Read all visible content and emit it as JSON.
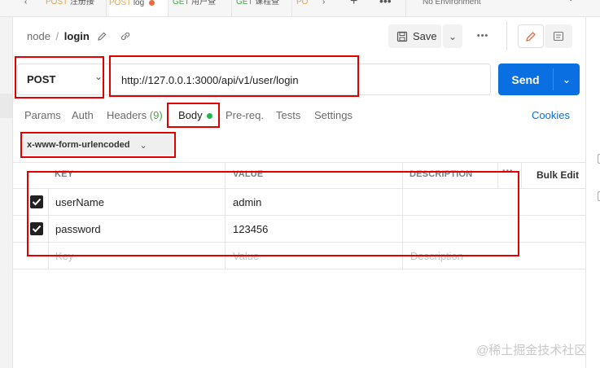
{
  "tabs": [
    {
      "method": "POST",
      "label": "注册接"
    },
    {
      "method": "POST",
      "label": "log",
      "unsaved": true
    },
    {
      "method": "GET",
      "label": "用户查"
    },
    {
      "method": "GET",
      "label": "课程查"
    },
    {
      "method": "PO",
      "label": ""
    }
  ],
  "environment": {
    "label": "No Environment"
  },
  "breadcrumb": {
    "parent": "node",
    "separator": "/",
    "current": "login"
  },
  "toolbar": {
    "save_label": "Save"
  },
  "request": {
    "method": "POST",
    "url": "http://127.0.0.1:3000/api/v1/user/login",
    "send_label": "Send"
  },
  "request_tabs": {
    "params": "Params",
    "auth": "Auth",
    "headers": "Headers",
    "headers_count": "(9)",
    "body": "Body",
    "prereq": "Pre-req.",
    "tests": "Tests",
    "settings": "Settings",
    "cookies": "Cookies"
  },
  "body_type": {
    "selected": "x-www-form-urlencoded"
  },
  "table": {
    "headers": {
      "key": "KEY",
      "value": "VALUE",
      "description": "DESCRIPTION",
      "bulk_edit": "Bulk Edit"
    },
    "rows": [
      {
        "checked": true,
        "key": "userName",
        "value": "admin",
        "description": ""
      },
      {
        "checked": true,
        "key": "password",
        "value": "123456",
        "description": ""
      }
    ],
    "placeholder": {
      "key": "Key",
      "value": "Value",
      "description": "Description"
    }
  },
  "watermark": "@稀土掘金技术社区",
  "colors": {
    "accent": "#0a6fe0",
    "post": "#e8a33d",
    "get": "#49a44a",
    "annotation": "#e00000",
    "body_dot": "#1fb84a"
  }
}
